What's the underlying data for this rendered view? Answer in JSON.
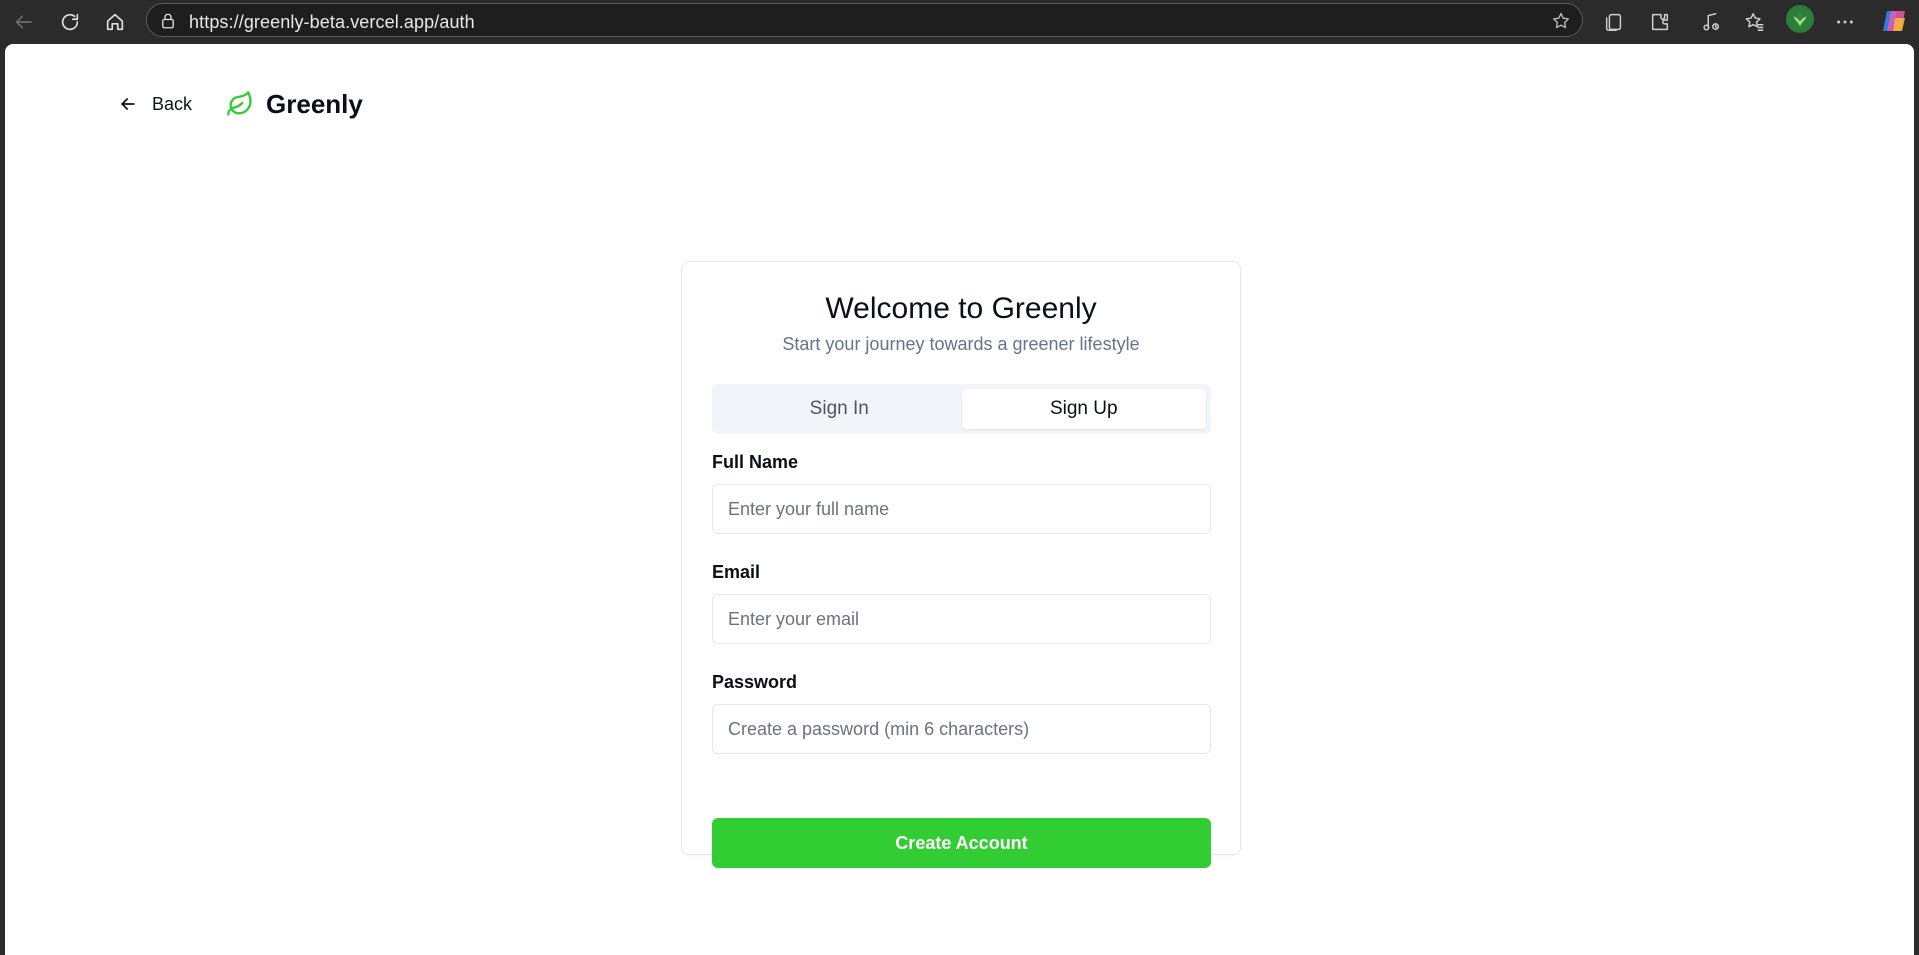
{
  "browser": {
    "url": "https://greenly-beta.vercel.app/auth",
    "icons": [
      "back-arrow-icon",
      "refresh-icon",
      "home-icon",
      "lock-icon",
      "star-icon",
      "collections-icon",
      "extensions-icon",
      "media-icon",
      "favorites-icon",
      "profile-avatar",
      "more-icon",
      "copilot-icon"
    ]
  },
  "header": {
    "back_label": "Back",
    "brand_name": "Greenly",
    "brand_color": "#32cd32"
  },
  "auth": {
    "title": "Welcome to Greenly",
    "subtitle": "Start your journey towards a greener lifestyle",
    "tabs": [
      {
        "label": "Sign In",
        "active": false
      },
      {
        "label": "Sign Up",
        "active": true
      }
    ],
    "fields": {
      "full_name": {
        "label": "Full Name",
        "placeholder": "Enter your full name",
        "value": ""
      },
      "email": {
        "label": "Email",
        "placeholder": "Enter your email",
        "value": ""
      },
      "password": {
        "label": "Password",
        "placeholder": "Create a password (min 6 characters)",
        "value": ""
      }
    },
    "submit_label": "Create Account",
    "accent_color": "#32cd32"
  }
}
